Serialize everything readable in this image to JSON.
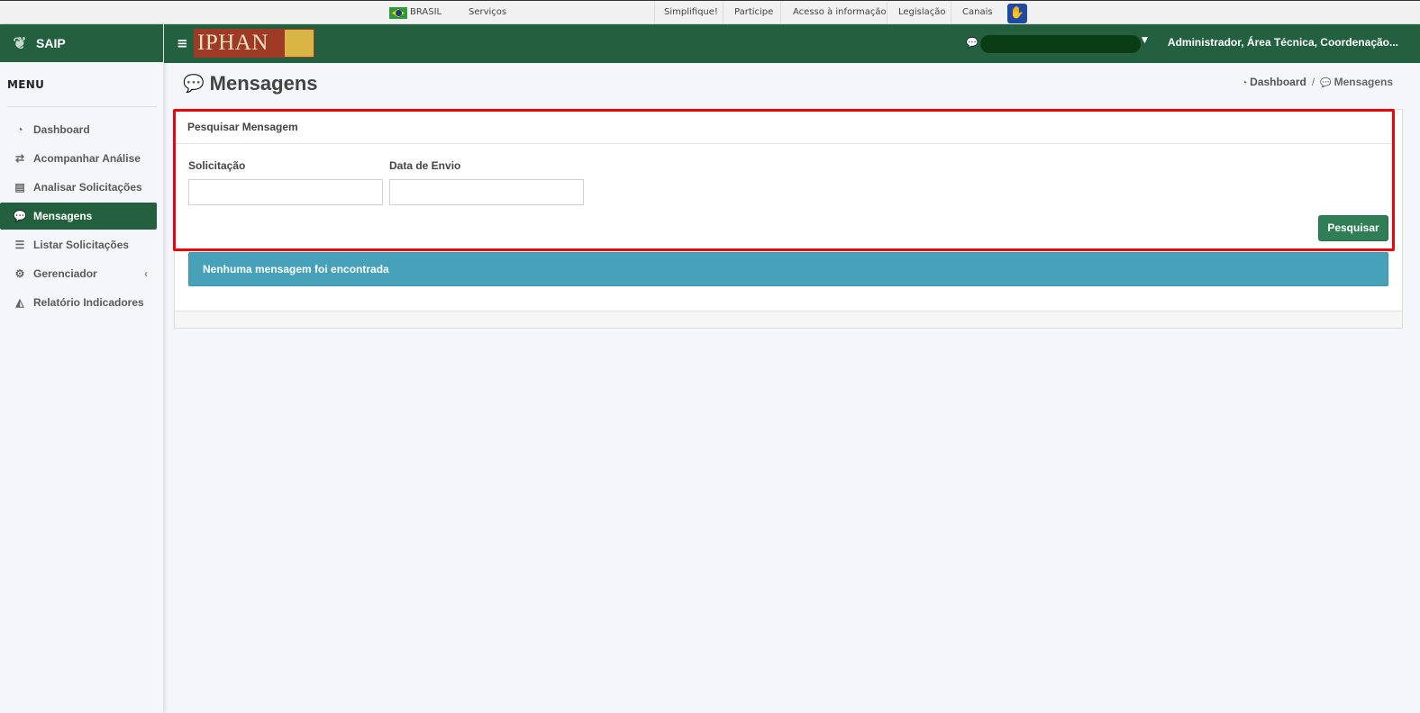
{
  "gov_bar": {
    "country": "BRASIL",
    "services": "Serviços",
    "links": [
      "Simplifique!",
      "Participe",
      "Acesso à informação",
      "Legislação",
      "Canais"
    ]
  },
  "sidebar": {
    "app_name": "SAIP",
    "menu_title": "MENU",
    "items": [
      {
        "label": "Dashboard",
        "icon": "dashboard-icon"
      },
      {
        "label": "Acompanhar Análise",
        "icon": "exchange-icon"
      },
      {
        "label": "Analisar Solicitações",
        "icon": "book-icon"
      },
      {
        "label": "Mensagens",
        "icon": "comments-icon",
        "active": true
      },
      {
        "label": "Listar Solicitações",
        "icon": "list-icon"
      },
      {
        "label": "Gerenciador",
        "icon": "cogs-icon",
        "has_submenu": true
      },
      {
        "label": "Relatório Indicadores",
        "icon": "area-chart-icon"
      }
    ]
  },
  "header": {
    "logo_text": "IPHAN",
    "user_roles": "Administrador, Área Técnica, Coordenação..."
  },
  "page": {
    "title": "Mensagens",
    "breadcrumb": [
      "Dashboard",
      "Mensagens"
    ]
  },
  "search_card": {
    "title": "Pesquisar Mensagem",
    "fields": [
      {
        "label": "Solicitação",
        "value": "",
        "placeholder": ""
      },
      {
        "label": "Data de Envio",
        "value": "",
        "placeholder": ""
      }
    ],
    "search_button": "Pesquisar"
  },
  "alert": {
    "message": "Nenhuma mensagem foi encontrada"
  },
  "colors": {
    "brand_green": "#23603f",
    "button_green": "#2f7e55",
    "alert_blue": "#46a1b9",
    "highlight_red": "#e8060b"
  }
}
